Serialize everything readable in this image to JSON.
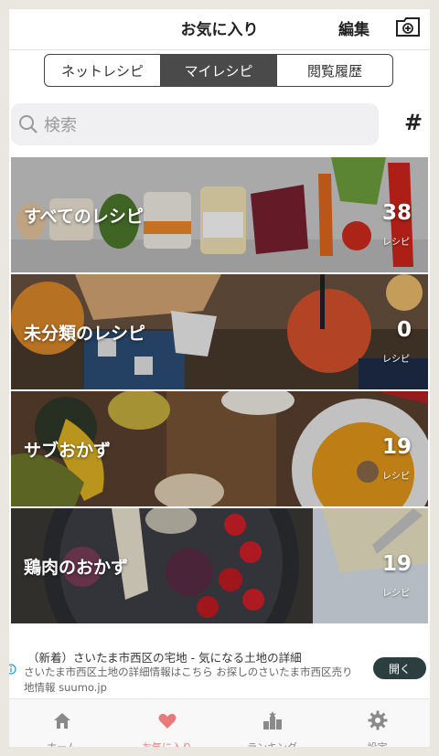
{
  "header": {
    "title": "お気に入り",
    "edit_label": "編集"
  },
  "segments": [
    {
      "label": "ネットレシピ",
      "active": false
    },
    {
      "label": "マイレシピ",
      "active": true
    },
    {
      "label": "閲覧履歴",
      "active": false
    }
  ],
  "search": {
    "placeholder": "検索",
    "tag_label": "#"
  },
  "collections": [
    {
      "name": "すべてのレシピ",
      "count": "38",
      "unit": "レシピ"
    },
    {
      "name": "未分類のレシピ",
      "count": "0",
      "unit": "レシピ"
    },
    {
      "name": "サブおかず",
      "count": "19",
      "unit": "レシピ"
    },
    {
      "name": "鶏肉のおかず",
      "count": "19",
      "unit": "レシピ"
    }
  ],
  "ad": {
    "headline": "（新着）さいたま市西区の宅地 - 気になる土地の詳細",
    "body": "さいたま市西区土地の詳細情報はこちら お探しのさいたま市西区売り地情報 suumo.jp",
    "button": "開く"
  },
  "tabbar": [
    {
      "label": "ホーム",
      "icon": "home-icon",
      "active": false
    },
    {
      "label": "お気に入り",
      "icon": "heart-icon",
      "active": true
    },
    {
      "label": "ランキング",
      "icon": "ranking-icon",
      "active": false
    },
    {
      "label": "設定",
      "icon": "gear-icon",
      "active": false
    }
  ],
  "colors": {
    "active_tab": "#e77b7b",
    "segment_active": "#4a4a4a",
    "ad_button": "#2c3e40"
  }
}
